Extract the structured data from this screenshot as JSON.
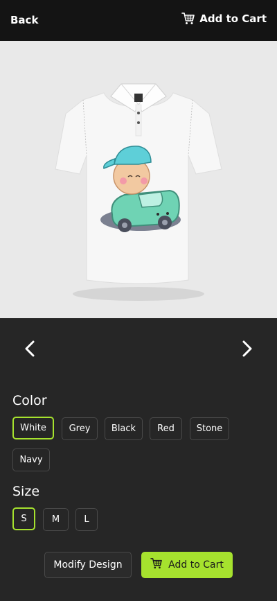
{
  "header": {
    "back_label": "Back",
    "cart_label": "Add to Cart"
  },
  "product": {
    "image_alt_icon": "product-shirt-image"
  },
  "navigation": {
    "prev_icon": "chevron-left-icon",
    "next_icon": "chevron-right-icon"
  },
  "color": {
    "label": "Color",
    "options": [
      "White",
      "Grey",
      "Black",
      "Red",
      "Stone",
      "Navy"
    ],
    "selected": "White"
  },
  "size": {
    "label": "Size",
    "options": [
      "S",
      "M",
      "L"
    ],
    "selected": "S"
  },
  "actions": {
    "modify_label": "Modify Design",
    "add_label": "Add to Cart"
  },
  "theme": {
    "accent": "#a6e22e",
    "background": "#262626",
    "header_bg": "#141414",
    "image_bg": "#e9e9e9"
  }
}
